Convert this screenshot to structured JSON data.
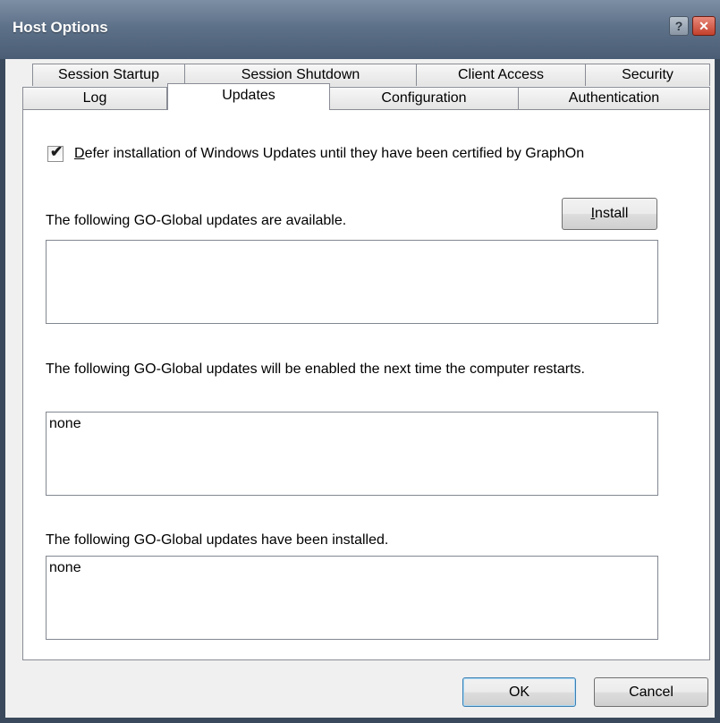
{
  "window": {
    "title": "Host Options"
  },
  "titlebar": {
    "help_glyph": "?",
    "close_glyph": "✕"
  },
  "tabs": {
    "row1": [
      "Session Startup",
      "Session Shutdown",
      "Client Access",
      "Security"
    ],
    "row2": [
      "Log",
      "Updates",
      "Configuration",
      "Authentication"
    ],
    "active": "Updates"
  },
  "updates": {
    "defer_checkbox": {
      "checked": true,
      "label_mnemonic": "D",
      "label_rest": "efer installation of Windows Updates until they have been certified by GraphOn"
    },
    "available_label": "The following GO-Global updates are available.",
    "install_button": {
      "mnemonic": "I",
      "rest": "nstall"
    },
    "available_list": [],
    "pending_label": "The following GO-Global updates will be enabled the next time the computer restarts.",
    "pending_list": [
      "none"
    ],
    "installed_label": "The following GO-Global updates have been installed.",
    "installed_list": [
      "none"
    ]
  },
  "footer": {
    "ok_label": "OK",
    "cancel_label": "Cancel"
  },
  "icons": {
    "checkmark": "check-icon",
    "help": "help-icon",
    "close": "close-icon"
  }
}
